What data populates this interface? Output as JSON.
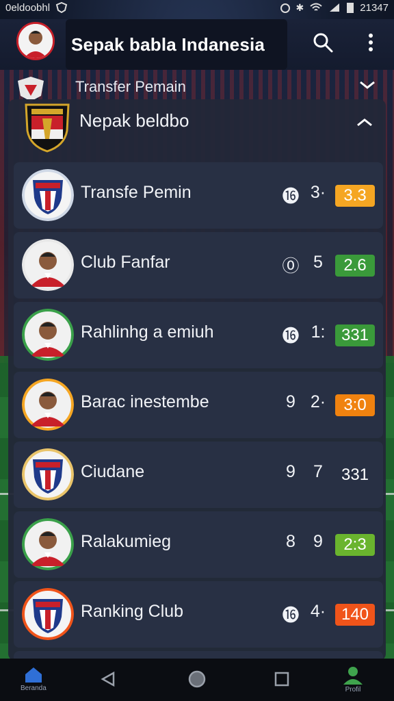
{
  "status": {
    "carrier": "0eldoobhl",
    "time": "21347"
  },
  "appbar": {
    "title": "Sepak babla Indanesia",
    "search_icon": "search-icon",
    "menu_icon": "more-vert-icon"
  },
  "sub_header": {
    "label": "Transfer Pemain"
  },
  "panel": {
    "title": "Nepak beldbo"
  },
  "rows": [
    {
      "name": "Transfe Pemin",
      "g1": "⓰",
      "g2": "3·",
      "badge": "3.3",
      "badge_color": "#f5a623"
    },
    {
      "name": "Club Fanfar",
      "g1": "⓪",
      "g2": "5",
      "badge": "2.6",
      "badge_color": "#3a9a3a"
    },
    {
      "name": "Rahlinhg a emiuh",
      "g1": "⓰",
      "g2": "1:",
      "badge": "331",
      "badge_color": "#3a9a3a"
    },
    {
      "name": "Barac inestembe",
      "g1": "9",
      "g2": "2·",
      "badge": "3:0",
      "badge_color": "#f0820f"
    },
    {
      "name": "Ciudane",
      "g1": "9",
      "g2": "7",
      "badge": "331",
      "badge_color": ""
    },
    {
      "name": "Ralakumieg",
      "g1": "8",
      "g2": "9",
      "badge": "2:3",
      "badge_color": "#6ab42e"
    },
    {
      "name": "Ranking Club",
      "g1": "⓰",
      "g2": "4·",
      "badge": "140",
      "badge_color": "#f0541a"
    }
  ],
  "nav": {
    "home_caption": "Beranda",
    "profile_caption": "Profil"
  }
}
